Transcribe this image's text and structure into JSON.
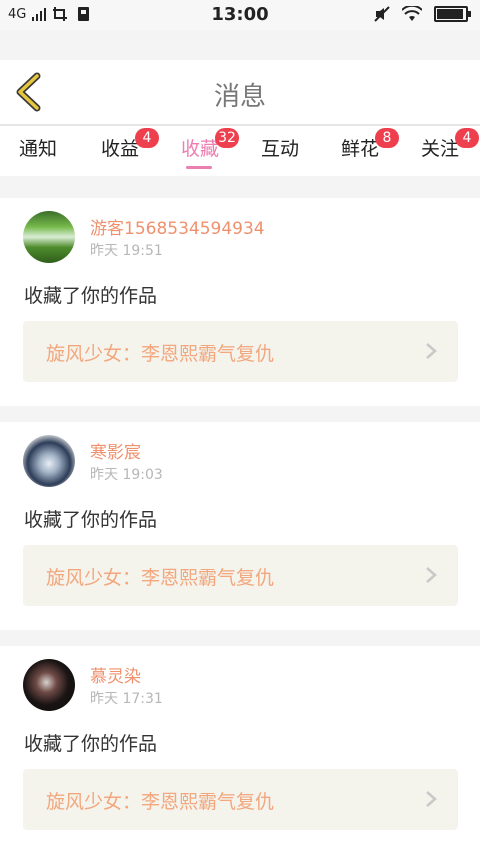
{
  "status_bar": {
    "network": "4G",
    "time": "13:00"
  },
  "header": {
    "title": "消息"
  },
  "tabs": [
    {
      "label": "通知",
      "badge": ""
    },
    {
      "label": "收益",
      "badge": "4"
    },
    {
      "label": "收藏",
      "badge": "32",
      "active": true
    },
    {
      "label": "互动",
      "badge": ""
    },
    {
      "label": "鲜花",
      "badge": "8"
    },
    {
      "label": "关注",
      "badge": "4"
    }
  ],
  "messages": [
    {
      "user": "游客1568534594934",
      "time": "昨天 19:51",
      "text": "收藏了你的作品",
      "work": "旋风少女：李恩熙霸气复仇"
    },
    {
      "user": "寒影宸",
      "time": "昨天 19:03",
      "text": "收藏了你的作品",
      "work": "旋风少女：李恩熙霸气复仇"
    },
    {
      "user": "慕灵染",
      "time": "昨天 17:31",
      "text": "收藏了你的作品",
      "work": "旋风少女：李恩熙霸气复仇"
    }
  ],
  "colors": {
    "accent_pink": "#ec7fb1",
    "badge_red": "#ee3f4f",
    "username_orange": "#f0916e",
    "work_title_orange": "#f2a77e",
    "back_arrow_yellow": "#e7c73d"
  },
  "icons": [
    "signal-icon",
    "screenshot-icon",
    "sim-icon",
    "mute-icon",
    "wifi-icon",
    "battery-icon",
    "back-arrow-icon",
    "chevron-right-icon"
  ]
}
